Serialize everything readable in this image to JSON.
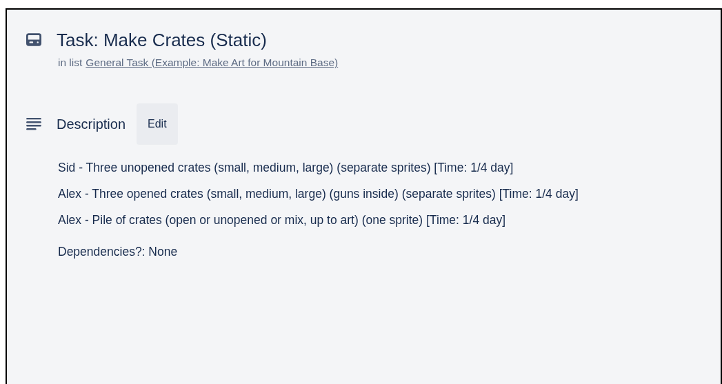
{
  "card": {
    "title": "Task: Make Crates (Static)",
    "list_prefix": "in list",
    "list_link": "General Task (Example: Make Art for Mountain Base)"
  },
  "description": {
    "heading": "Description",
    "edit_button": "Edit",
    "lines": [
      "Sid - Three unopened crates (small, medium, large) (separate sprites) [Time: 1/4 day]",
      "Alex - Three opened crates (small, medium, large) (guns inside) (separate sprites) [Time: 1/4 day]",
      "Alex - Pile of crates (open or unopened or mix, up to art) (one sprite) [Time: 1/4 day]"
    ],
    "dependencies": "Dependencies?: None"
  }
}
